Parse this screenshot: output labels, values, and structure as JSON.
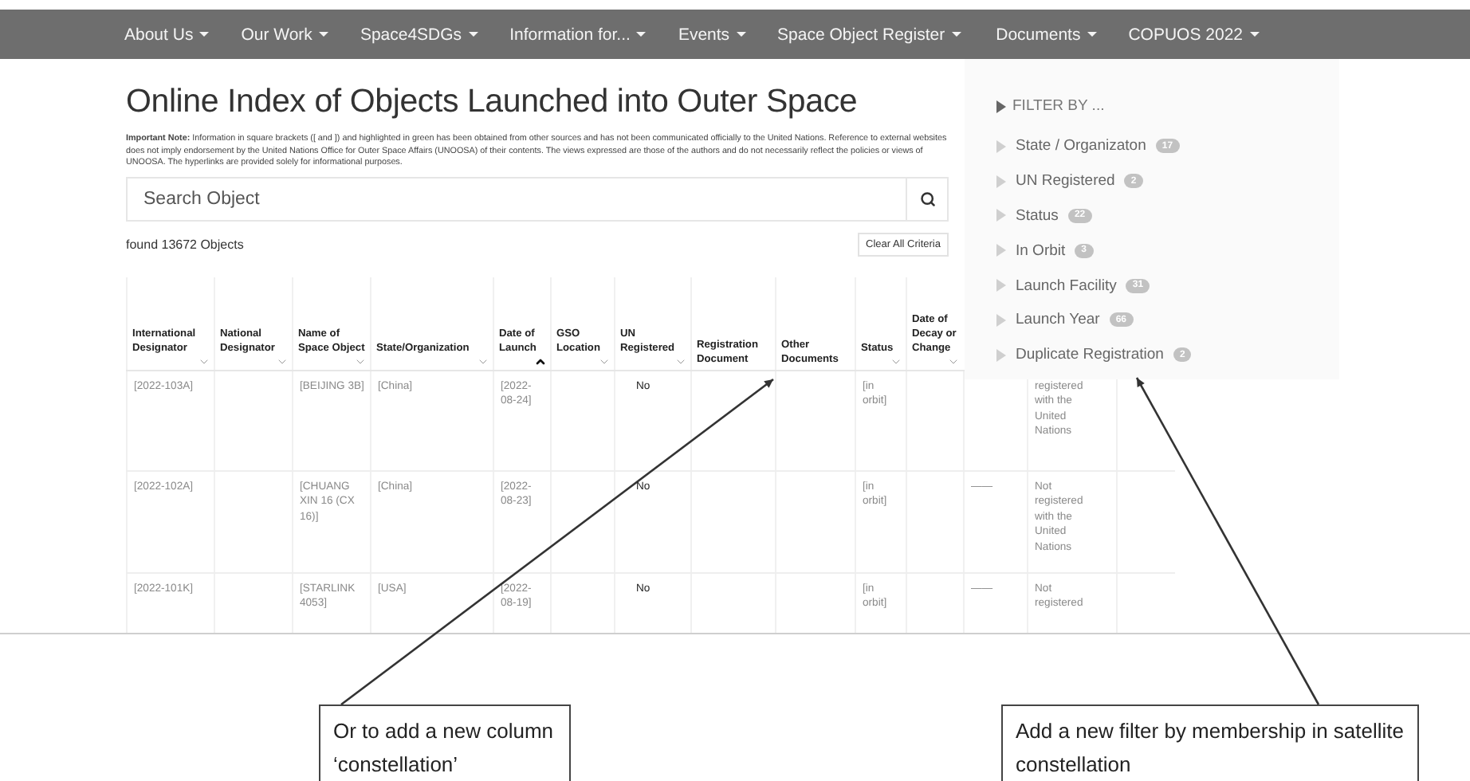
{
  "nav": [
    {
      "label": "About Us"
    },
    {
      "label": "Our Work"
    },
    {
      "label": "Space4SDGs"
    },
    {
      "label": "Information for..."
    },
    {
      "label": "Events"
    },
    {
      "label": "Space Object Register"
    },
    {
      "label": "Documents"
    },
    {
      "label": "COPUOS 2022"
    }
  ],
  "title": "Online Index of Objects Launched into Outer Space",
  "note": "**Important Note:** Information in square brackets ([ and ]) and highlighted in green has been obtained from other sources and has not been communicated officially to the United Nations. Reference to external websites does not imply endorsement by the United Nations Office for Outer Space Affairs (UNOOSA) of their contents. The views expressed are those of the authors and do not necessarily reflect the policies or views of UNOOSA. The hyperlinks are provided solely for informational purposes.",
  "search": {
    "placeholder": "Search Object"
  },
  "found": "found 13672 Objects",
  "clear_button": "Clear All Criteria",
  "table": {
    "columns": [
      {
        "label": "International Designator",
        "sortable": true,
        "sorted": false
      },
      {
        "label": "National Designator",
        "sortable": true,
        "sorted": false
      },
      {
        "label": "Name of Space Object",
        "sortable": true,
        "sorted": false
      },
      {
        "label": "State/Organization",
        "sortable": true,
        "sorted": false
      },
      {
        "label": "Date of Launch",
        "sortable": true,
        "sorted": true
      },
      {
        "label": "GSO Location",
        "sortable": true,
        "sorted": false
      },
      {
        "label": "UN Registered",
        "sortable": true,
        "sorted": false
      },
      {
        "label": "Registration Document",
        "sortable": false
      },
      {
        "label": "Other Documents",
        "sortable": false
      },
      {
        "label": "Status",
        "sortable": true,
        "sorted": false
      },
      {
        "label": "Date of Decay or Change",
        "sortable": true,
        "sorted": false
      }
    ],
    "rows": [
      {
        "international_designator": "[2022-103A]",
        "name": "[BEIJING 3B]",
        "state": "[China]",
        "launch_date": "[2022-08-24]",
        "un_registered": "No",
        "status": "[in orbit]",
        "remarks": "registered with the United Nations"
      },
      {
        "international_designator": "[2022-102A]",
        "name": "[CHUANG XIN 16 (CX 16)]",
        "state": "[China]",
        "launch_date": "[2022-08-23]",
        "un_registered": "No",
        "status": "[in orbit]",
        "column_12": "——",
        "remarks": "Not registered with the United Nations"
      },
      {
        "international_designator": "[2022-101K]",
        "name": "[STARLINK 4053]",
        "state": "[USA]",
        "launch_date": "[2022-08-19]",
        "un_registered": "No",
        "status": "[in orbit]",
        "column_12": "——",
        "remarks": "Not registered"
      }
    ]
  },
  "filter": {
    "title": "FILTER BY ...",
    "items": [
      {
        "label": "State / Organizaton",
        "count": "17"
      },
      {
        "label": "UN Registered",
        "count": "2"
      },
      {
        "label": "Status",
        "count": "22"
      },
      {
        "label": "In Orbit",
        "count": "3"
      },
      {
        "label": "Launch Facility",
        "count": "31"
      },
      {
        "label": "Launch Year",
        "count": "66"
      },
      {
        "label": "Duplicate Registration",
        "count": "2"
      }
    ]
  },
  "annotations": [
    {
      "text": "Or to add a new column ‘constellation’"
    },
    {
      "text": "Add a new filter by membership in satellite constellation"
    }
  ]
}
